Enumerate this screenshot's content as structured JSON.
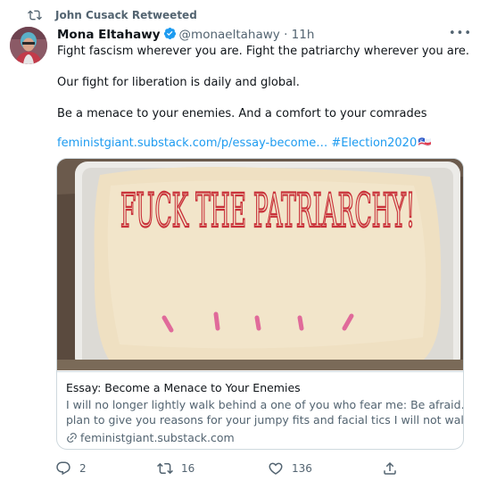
{
  "retweet_header": {
    "text": "John Cusack Retweeted"
  },
  "author": {
    "name": "Mona Eltahawy",
    "handle": "@monaeltahawy",
    "separator": "·",
    "time": "11h",
    "verified": true
  },
  "tweet": {
    "line1": "Fight fascism wherever you are. Fight the patriarchy wherever you are.",
    "line2": "Our fight for liberation is daily and global.",
    "line3": "Be a menace to your enemies. And a comfort to your comrades",
    "link_text": "feministgiant.substack.com/p/essay-become…",
    "hashtag": "#Election2020"
  },
  "card": {
    "image_text": "FUCK THE PATRIARCHY!",
    "title": "Essay: Become a Menace to Your Enemies",
    "desc_line1": "I will no longer lightly walk behind a one of you who fear me: Be afraid. I",
    "desc_line2": "plan to give you reasons for your jumpy fits and facial tics I will not walk…",
    "domain": "feministgiant.substack.com"
  },
  "actions": {
    "replies": "2",
    "retweets": "16",
    "likes": "136"
  },
  "colors": {
    "link": "#1d9bf0",
    "muted": "#536471",
    "text": "#0f1419",
    "verified": "#1d9bf0",
    "border": "#cfd9de"
  },
  "icons": [
    "retweet-icon",
    "verified-badge-icon",
    "more-icon",
    "flag-icon",
    "link-icon",
    "reply-icon",
    "like-icon",
    "share-icon"
  ]
}
